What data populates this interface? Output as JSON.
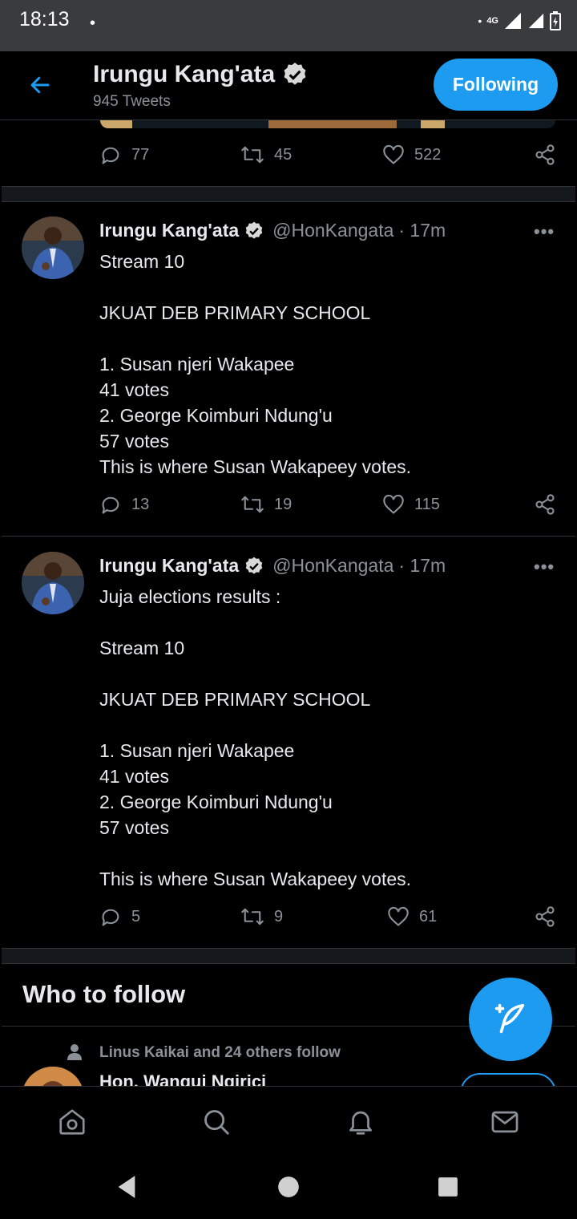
{
  "status_bar": {
    "time": "18:13",
    "dot": "•",
    "network": "4G"
  },
  "profile_header": {
    "name": "Irungu Kang'ata",
    "tweet_count": "945 Tweets",
    "follow_label": "Following",
    "back_icon": "arrow-left-icon"
  },
  "top_tweet_actions": {
    "replies": "77",
    "retweets": "45",
    "likes": "522"
  },
  "tweets": [
    {
      "name": "Irungu Kang'ata",
      "handle": "@HonKangata",
      "time": "· 17m",
      "more": "•••",
      "body": "Stream 10\n\nJKUAT DEB PRIMARY SCHOOL\n\n1. Susan njeri Wakapee\n41 votes\n2. George Koimburi Ndung'u\n57 votes\nThis is where Susan Wakapeey votes.",
      "replies": "13",
      "retweets": "19",
      "likes": "115"
    },
    {
      "name": "Irungu Kang'ata",
      "handle": "@HonKangata",
      "time": "· 17m",
      "more": "•••",
      "body": "Juja elections results :\n\nStream 10\n\nJKUAT DEB PRIMARY SCHOOL\n\n1. Susan njeri Wakapee\n41 votes\n2. George Koimburi Ndung'u\n57 votes\n\nThis is where Susan Wakapeey votes.",
      "replies": "5",
      "retweets": "9",
      "likes": "61"
    }
  ],
  "who_to_follow": {
    "title": "Who to follow",
    "social_context": "Linus Kaikai and 24 others follow",
    "suggestion_name": "Hon. Wangui Ngirici"
  },
  "colors": {
    "accent": "#1d9bf0",
    "muted": "#8b9198",
    "background": "#000000"
  }
}
